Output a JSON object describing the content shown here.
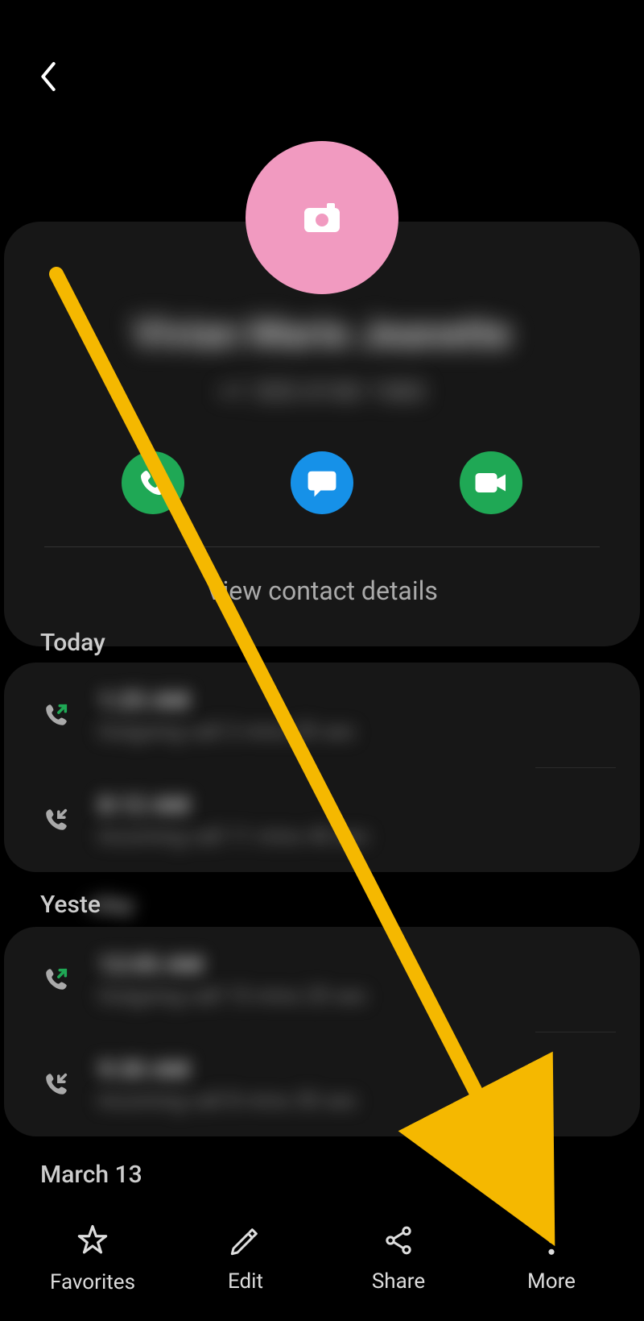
{
  "avatar_color": "#f19ac0",
  "contact": {
    "name": "Vivian Marie Jeanette",
    "phone": "+1 555 0100 1583",
    "view_details": "View contact details"
  },
  "sections": {
    "today": "Today",
    "yesterday": "Yeste",
    "yesterday_blur": "rday",
    "march": "March 13"
  },
  "calls": {
    "group1": [
      {
        "time": "1:25 AM",
        "detail": "Outgoing call 2 mins 30 sec"
      },
      {
        "time": "8:12 AM",
        "detail": "Incoming call 11 mins 40 sec"
      }
    ],
    "group2": [
      {
        "time": "12:05 AM",
        "detail": "Outgoing call 15 mins 20 sec"
      },
      {
        "time": "9:30 AM",
        "detail": "Incoming call 8 mins 50 sec"
      }
    ]
  },
  "nav": {
    "favorites": "Favorites",
    "edit": "Edit",
    "share": "Share",
    "more": "More"
  }
}
